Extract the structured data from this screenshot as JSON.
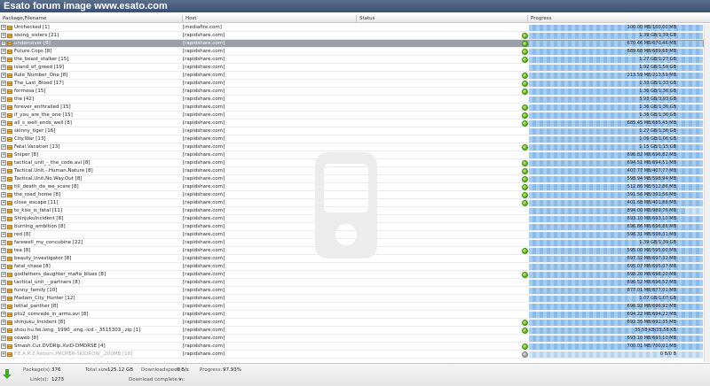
{
  "banner": {
    "title": "Esato forum image www.esato.com"
  },
  "columns": {
    "package": "Package,Filename",
    "host": "Host",
    "status": "Status",
    "progress": "Progress"
  },
  "packages": [
    {
      "name": "Unchecked [1]",
      "host": "[mediafire.com]",
      "progress": "100.00 MB/100.00 MB",
      "fraction": 1.0,
      "done": false,
      "state": ""
    },
    {
      "name": "soong_sisters [21]",
      "host": "[rapidshare.com]",
      "progress": "1.39 GB/1.39 GB",
      "fraction": 1.0,
      "done": true,
      "state": ""
    },
    {
      "name": "undercover [8]",
      "host": "[rapidshare.com]",
      "progress": "670.46 MB/670.46 MB",
      "fraction": 1.0,
      "done": true,
      "state": "selected"
    },
    {
      "name": "Future.Cops [8]",
      "host": "[rapidshare.com]",
      "progress": "689.68 MB/689.68 MB",
      "fraction": 1.0,
      "done": true,
      "state": ""
    },
    {
      "name": "the_beast_stalker [15]",
      "host": "[rapidshare.com]",
      "progress": "1.27 GB/1.27 GB",
      "fraction": 1.0,
      "done": true,
      "state": ""
    },
    {
      "name": "island_of_greed [19]",
      "host": "[rapidshare.com]",
      "progress": "1.92 GB/1.59 GB",
      "fraction": 1.0,
      "done": false,
      "state": ""
    },
    {
      "name": "Rule_Number_One [8]",
      "host": "[rapidshare.com]",
      "progress": "213.59 MB/213.59 MB",
      "fraction": 1.0,
      "done": true,
      "state": ""
    },
    {
      "name": "The_Last_Blood [17]",
      "host": "[rapidshare.com]",
      "progress": "1.33 GB/1.33 GB",
      "fraction": 1.0,
      "done": true,
      "state": ""
    },
    {
      "name": "formosa [15]",
      "host": "[rapidshare.com]",
      "progress": "1.36 GB/1.36 GB",
      "fraction": 1.0,
      "done": true,
      "state": ""
    },
    {
      "name": "the [42]",
      "host": "[rapidshare.com]",
      "progress": "3.93 GB/3.93 GB",
      "fraction": 1.0,
      "done": false,
      "state": ""
    },
    {
      "name": "forever_enthralled [15]",
      "host": "[rapidshare.com]",
      "progress": "1.36 GB/1.36 GB",
      "fraction": 1.0,
      "done": true,
      "state": ""
    },
    {
      "name": "if_you_are_the_one [15]",
      "host": "[rapidshare.com]",
      "progress": "1.36 GB/1.36 GB",
      "fraction": 1.0,
      "done": true,
      "state": ""
    },
    {
      "name": "all_s_well_ends_well [8]",
      "host": "[rapidshare.com]",
      "progress": "685.45 MB/685.45 MB",
      "fraction": 1.0,
      "done": true,
      "state": ""
    },
    {
      "name": "skinny_tiger [16]",
      "host": "[rapidshare.com]",
      "progress": "1.27 GB/1.36 GB",
      "fraction": 1.0,
      "done": false,
      "state": ""
    },
    {
      "name": "City.War [13]",
      "host": "[rapidshare.com]",
      "progress": "1.06 GB/1.06 GB",
      "fraction": 1.0,
      "done": false,
      "state": ""
    },
    {
      "name": "Fatal.Vacation [13]",
      "host": "[rapidshare.com]",
      "progress": "1.15 GB/1.15 GB",
      "fraction": 1.0,
      "done": true,
      "state": ""
    },
    {
      "name": "Sniper [8]",
      "host": "[rapidshare.com]",
      "progress": "696.82 MB/696.82 MB",
      "fraction": 1.0,
      "done": false,
      "state": ""
    },
    {
      "name": "tactical_unit_-_the_code.avi [8]",
      "host": "[rapidshare.com]",
      "progress": "694.51 MB/694.51 MB",
      "fraction": 1.0,
      "done": true,
      "state": ""
    },
    {
      "name": "Tactical.Unit.-.Human.Nature [8]",
      "host": "[rapidshare.com]",
      "progress": "407.77 MB/407.77 MB",
      "fraction": 1.0,
      "done": true,
      "state": ""
    },
    {
      "name": "Tactical.Unit.No.Way.Out [8]",
      "host": "[rapidshare.com]",
      "progress": "598.94 MB/598.94 MB",
      "fraction": 1.0,
      "done": true,
      "state": ""
    },
    {
      "name": "till_death_do_we_scare [8]",
      "host": "[rapidshare.com]",
      "progress": "512.86 MB/512.86 MB",
      "fraction": 1.0,
      "done": true,
      "state": ""
    },
    {
      "name": "the_road_home [8]",
      "host": "[rapidshare.com]",
      "progress": "391.56 MB/391.56 MB",
      "fraction": 1.0,
      "done": true,
      "state": ""
    },
    {
      "name": "close_escape [11]",
      "host": "[rapidshare.com]",
      "progress": "401.68 MB/401.88 MB",
      "fraction": 1.0,
      "done": true,
      "state": ""
    },
    {
      "name": "to_kiss_is_fatal [11]",
      "host": "[rapidshare.com]",
      "progress": "894.00 MB/989.76 MB",
      "fraction": 0.9,
      "done": false,
      "state": ""
    },
    {
      "name": "ShinjukuIncident [8]",
      "host": "[rapidshare.com]",
      "progress": "693.10 MB/693.10 MB",
      "fraction": 1.0,
      "done": false,
      "state": ""
    },
    {
      "name": "burning_ambition [8]",
      "host": "[rapidshare.com]",
      "progress": "696.86 MB/696.86 MB",
      "fraction": 1.0,
      "done": false,
      "state": ""
    },
    {
      "name": "red [8]",
      "host": "[rapidshare.com]",
      "progress": "598.31 MB/598.31 MB",
      "fraction": 1.0,
      "done": false,
      "state": ""
    },
    {
      "name": "farewell_my_concubine [22]",
      "host": "[rapidshare.com]",
      "progress": "1.39 GB/1.39 GB",
      "fraction": 1.0,
      "done": false,
      "state": ""
    },
    {
      "name": "tea [8]",
      "host": "[rapidshare.com]",
      "progress": "595.00 MB/595.00 MB",
      "fraction": 1.0,
      "done": true,
      "state": ""
    },
    {
      "name": "beauty_investigator [8]",
      "host": "[rapidshare.com]",
      "progress": "697.32 MB/697.32 MB",
      "fraction": 1.0,
      "done": false,
      "state": ""
    },
    {
      "name": "fatal_chase [8]",
      "host": "[rapidshare.com]",
      "progress": "695.07 MB/695.07 MB",
      "fraction": 1.0,
      "done": false,
      "state": ""
    },
    {
      "name": "godfathers_daughter_mafia_blues [8]",
      "host": "[rapidshare.com]",
      "progress": "698.20 MB/698.20 MB",
      "fraction": 1.0,
      "done": true,
      "state": ""
    },
    {
      "name": "tactical_unit_-_partners [8]",
      "host": "[rapidshare.com]",
      "progress": "696.52 MB/696.52 MB",
      "fraction": 1.0,
      "done": false,
      "state": ""
    },
    {
      "name": "funny_family [10]",
      "host": "[rapidshare.com]",
      "progress": "877.01 MB/877.01 MB",
      "fraction": 1.0,
      "done": false,
      "state": ""
    },
    {
      "name": "Madam_City_Hunter [12]",
      "host": "[rapidshare.com]",
      "progress": "1.07 GB/1.07 GB",
      "fraction": 1.0,
      "done": false,
      "state": ""
    },
    {
      "name": "lethal_panther [8]",
      "host": "[rapidshare.com]",
      "progress": "696.92 MB/696.92 MB",
      "fraction": 1.0,
      "done": false,
      "state": ""
    },
    {
      "name": "ptu2_comrade_in_arms.avi [8]",
      "host": "[rapidshare.com]",
      "progress": "694.22 MB/694.22 MB",
      "fraction": 1.0,
      "done": false,
      "state": ""
    },
    {
      "name": "shinjuku_incident [8]",
      "host": "[rapidshare.com]",
      "progress": "692.35 MB/692.35 MB",
      "fraction": 1.0,
      "done": true,
      "state": ""
    },
    {
      "name": "shou.hu.fei.long._1990_.eng.-lcd.-_3515303_.zip [1]",
      "host": "[rapidshare.com]",
      "progress": "35.58 KB/35.58 KB",
      "fraction": 1.0,
      "done": true,
      "state": ""
    },
    {
      "name": "coweb [8]",
      "host": "[rapidshare.com]",
      "progress": "693.10 MB/693.10 MB",
      "fraction": 1.0,
      "done": false,
      "state": ""
    },
    {
      "name": "Smash.Cut.DVDRip.XviD-DMDRSE [4]",
      "host": "[rapidshare.com]",
      "progress": "700.01 MB/700.01 MB",
      "fraction": 1.0,
      "done": true,
      "state": ""
    },
    {
      "name": "F.E.A.R.2.Reborn.PROPER-SKIDROW_.200MB [18]",
      "host": "[rapidshare.com]",
      "progress": "0 B/0 B",
      "fraction": 0.0,
      "done": false,
      "state": "disabled"
    }
  ],
  "footer": {
    "packages_label": "Package(s):",
    "packages_value": "376",
    "links_label": "Link(s):",
    "links_value": "1273",
    "total_size_label": "Total size:",
    "total_size_value": "125.12 GB",
    "speed_label": "Downloadspeed:",
    "speed_value": "0 B/s",
    "complete_label": "Download complete in:",
    "complete_value": "~",
    "progress_label": "Progress:",
    "progress_value": "97.93%"
  },
  "colors": {
    "banner": "#3f5677",
    "selected_row": "#9aa0a8",
    "progress_bar": "#b7d4ef",
    "finished_dot": "#58a818"
  },
  "icons": {
    "expand": "plus-box-icon",
    "package": "folder-icon",
    "status": "finished-dot-icon",
    "download": "download-arrow-icon"
  }
}
